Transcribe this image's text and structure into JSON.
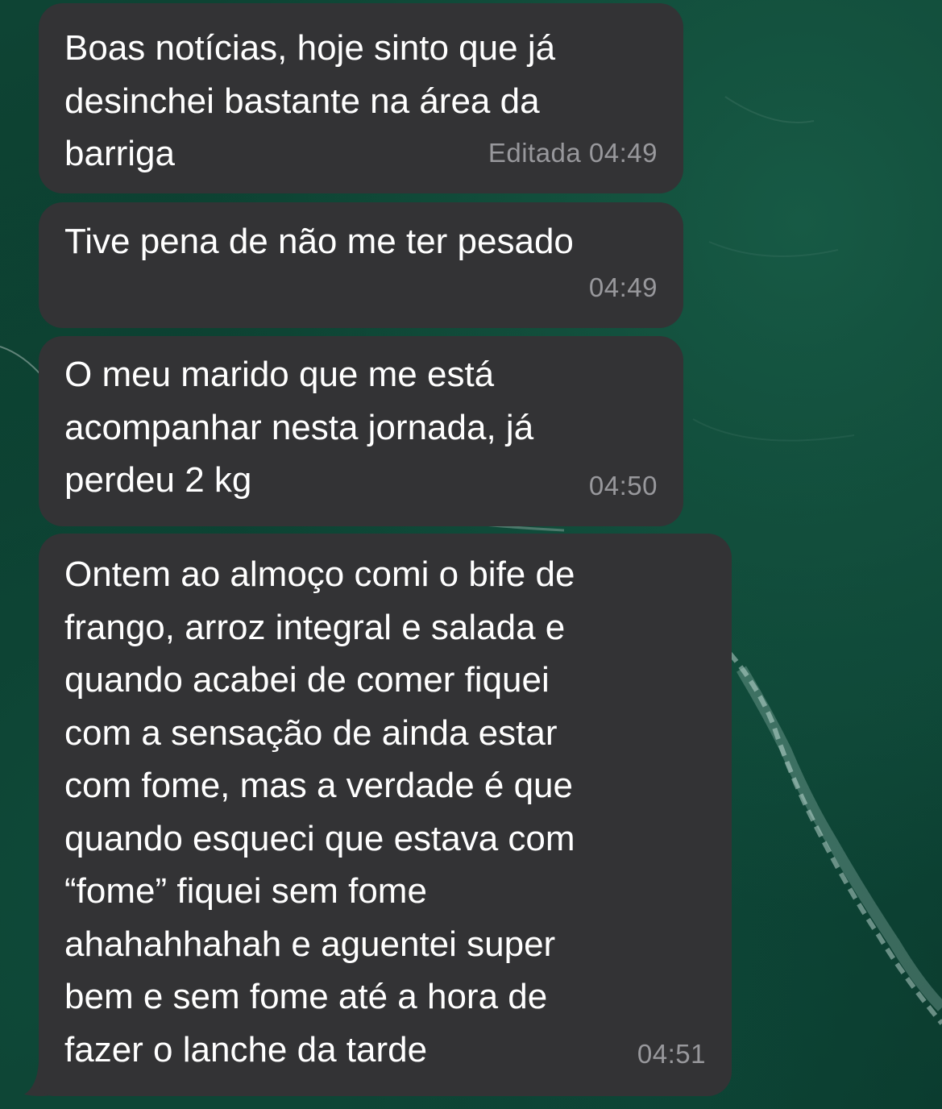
{
  "colors": {
    "bubble": "#333335",
    "text": "#ffffff",
    "meta": "#98989c",
    "wallpaper": "#0b3a2e"
  },
  "messages": [
    {
      "text": "Boas notícias, hoje sinto que já\ndesinchei bastante na área da\nbarriga",
      "meta": "Editada 04:49"
    },
    {
      "text": "Tive pena de não me ter pesado",
      "meta": "04:49"
    },
    {
      "text": "O meu marido que me está\nacompanhar nesta jornada, já\nperdeu 2 kg",
      "meta": "04:50"
    },
    {
      "text": "Ontem ao almoço comi o bife de\nfrango, arroz integral e salada e\nquando acabei de comer fiquei\ncom a sensação de ainda estar\ncom fome, mas a verdade é que\nquando esqueci que estava com\n“fome” fiquei sem fome\nahahahhahah e aguentei super\nbem e sem fome até a hora de\nfazer o lanche da tarde",
      "meta": "04:51"
    }
  ]
}
